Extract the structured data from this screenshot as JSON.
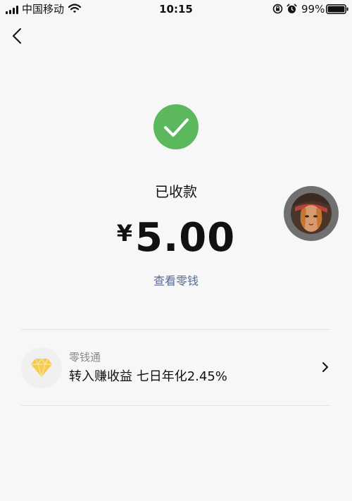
{
  "status_bar": {
    "carrier": "中国移动",
    "time": "10:15",
    "battery_percent": "99%"
  },
  "icons": {
    "back": "chevron-left-icon",
    "success": "checkmark-circle-icon",
    "lingqiantong": "diamond-icon",
    "card_arrow": "chevron-right-icon"
  },
  "colors": {
    "success_green": "#5cb85c",
    "link_blue": "#576b95",
    "diamond_gold": "#f3cb4d",
    "background": "#f7f7f7"
  },
  "main": {
    "status_text": "已收款",
    "currency_symbol": "¥",
    "amount": "5.00",
    "view_change_link": "查看零钱"
  },
  "card": {
    "title": "零钱通",
    "description": "转入赚收益 七日年化2.45%"
  }
}
